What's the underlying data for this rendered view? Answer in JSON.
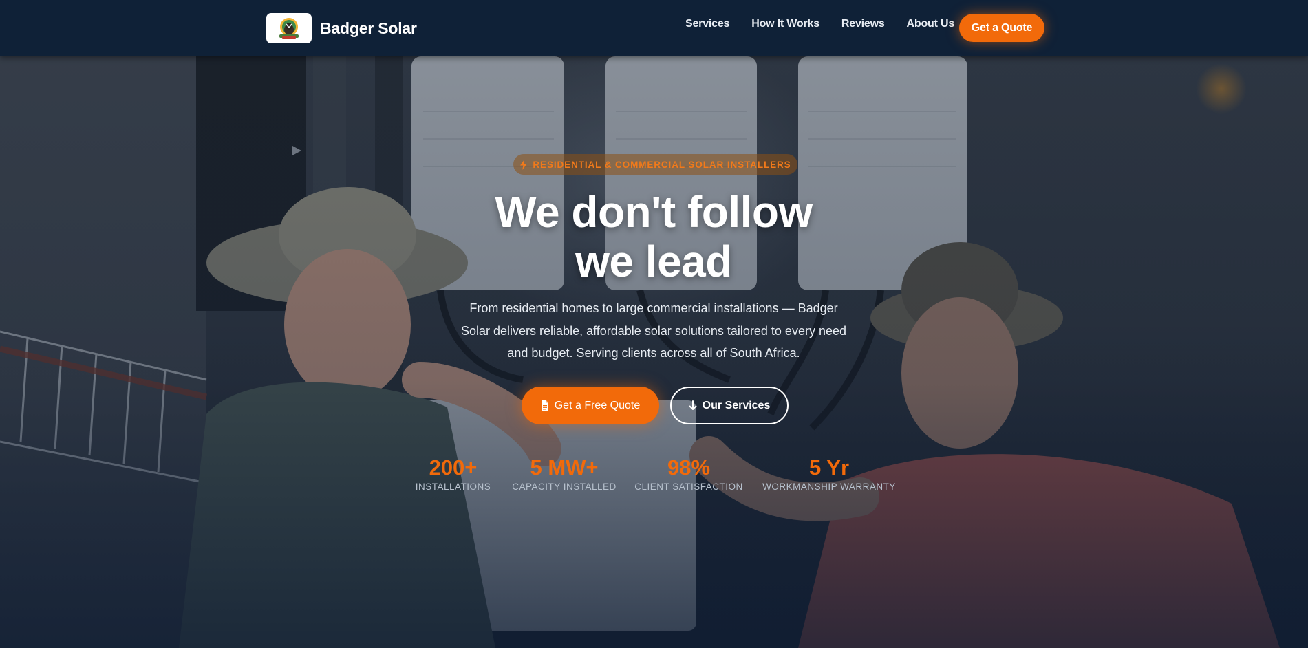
{
  "brand": {
    "name": "Badger Solar",
    "logo_icon": "badger-logo-icon"
  },
  "nav": {
    "items": [
      {
        "label": "Services"
      },
      {
        "label": "How It Works"
      },
      {
        "label": "Reviews"
      },
      {
        "label": "About Us"
      }
    ],
    "quote_label": "Get a Quote"
  },
  "hero": {
    "badge_icon": "lightning-bolt-icon",
    "badge_text": "RESIDENTIAL & COMMERCIAL SOLAR INSTALLERS",
    "headline_line1": "We don't follow",
    "headline_line2": "we lead",
    "lead": "From residential homes to large commercial installations — Badger Solar delivers reliable, affordable solar solutions tailored to every need and budget. Serving clients across all of South Africa.",
    "cta_primary": {
      "icon": "document-icon",
      "label": "Get a Free Quote"
    },
    "cta_secondary": {
      "icon": "arrow-down-icon",
      "label": "Our Services"
    },
    "stats": [
      {
        "value": "200+",
        "label": "INSTALLATIONS"
      },
      {
        "value": "5 MW+",
        "label": "CAPACITY INSTALLED"
      },
      {
        "value": "98%",
        "label": "CLIENT SATISFACTION"
      },
      {
        "value": "5 Yr",
        "label": "WORKMANSHIP WARRANTY"
      }
    ]
  },
  "colors": {
    "accent": "#f26a0a",
    "nav_bg": "#0f2137",
    "hero_overlay": "#101e34",
    "text_muted": "#b7c1cd"
  }
}
